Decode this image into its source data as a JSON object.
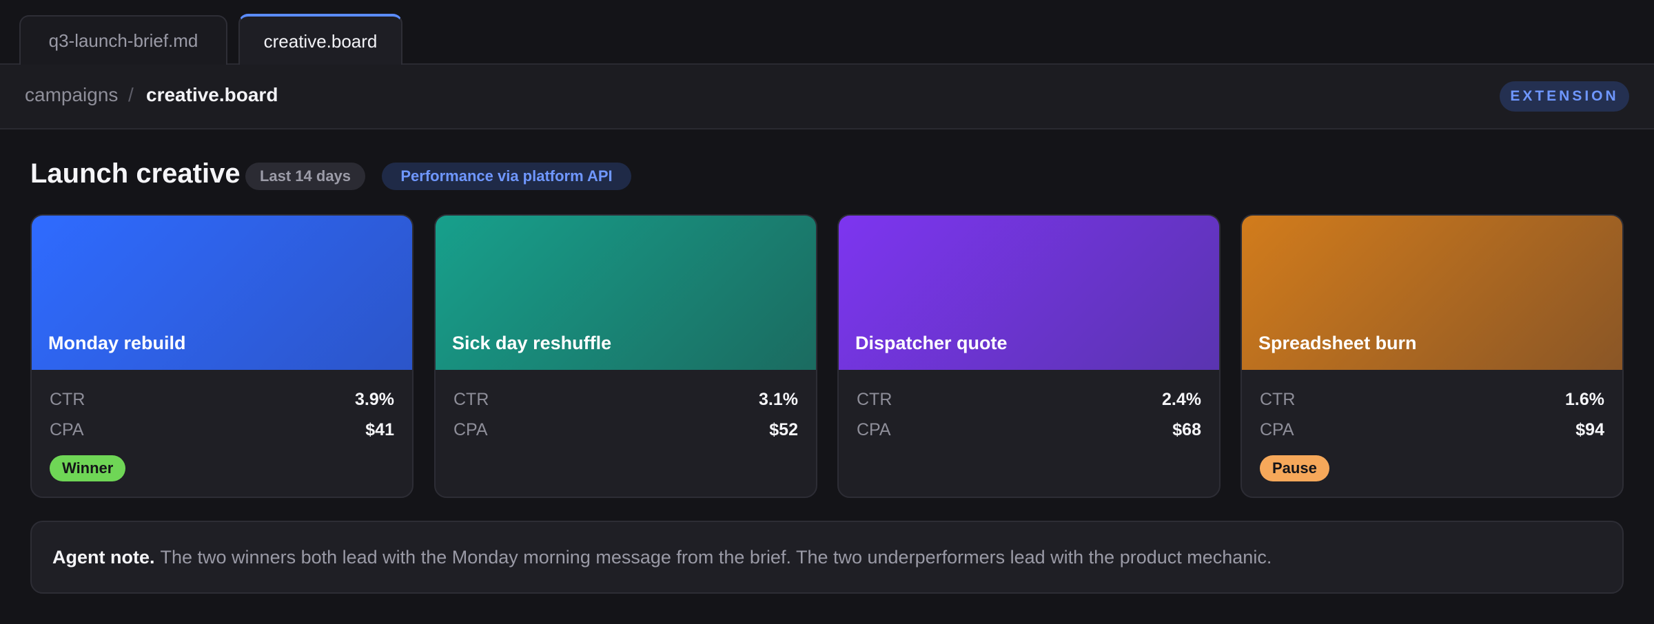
{
  "tabs": [
    {
      "label": "q3-launch-brief.md",
      "active": false
    },
    {
      "label": "creative.board",
      "active": true
    }
  ],
  "breadcrumb": {
    "parent": "campaigns",
    "separator": "/",
    "current": "creative.board"
  },
  "extension_badge": "EXTENSION",
  "section": {
    "title": "Launch creative",
    "range_pill": "Last 14 days",
    "source_pill": "Performance via platform API"
  },
  "cards": [
    {
      "title": "Monday rebuild",
      "ctr_label": "CTR",
      "ctr": "3.9%",
      "cpa_label": "CPA",
      "cpa": "$41",
      "status": "Winner",
      "status_color": "#6fd656",
      "gradient": [
        "#2f6bff",
        "#2c55c9"
      ]
    },
    {
      "title": "Sick day reshuffle",
      "ctr_label": "CTR",
      "ctr": "3.1%",
      "cpa_label": "CPA",
      "cpa": "$52",
      "status": "",
      "status_color": "",
      "gradient": [
        "#17a08c",
        "#1b6b60"
      ]
    },
    {
      "title": "Dispatcher quote",
      "ctr_label": "CTR",
      "ctr": "2.4%",
      "cpa_label": "CPA",
      "cpa": "$68",
      "status": "",
      "status_color": "",
      "gradient": [
        "#7d35f0",
        "#5a34b0"
      ]
    },
    {
      "title": "Spreadsheet burn",
      "ctr_label": "CTR",
      "ctr": "1.6%",
      "cpa_label": "CPA",
      "cpa": "$94",
      "status": "Pause",
      "status_color": "#f6a85a",
      "gradient": [
        "#d27c1c",
        "#8a5626"
      ]
    }
  ],
  "agent_note": {
    "lead": "Agent note.",
    "text": "The two winners both lead with the Monday morning message from the brief. The two underperformers lead with the product mechanic."
  },
  "colors": {
    "accent": "#5b8cff",
    "background": "#141418",
    "panel": "#1f1f25"
  }
}
